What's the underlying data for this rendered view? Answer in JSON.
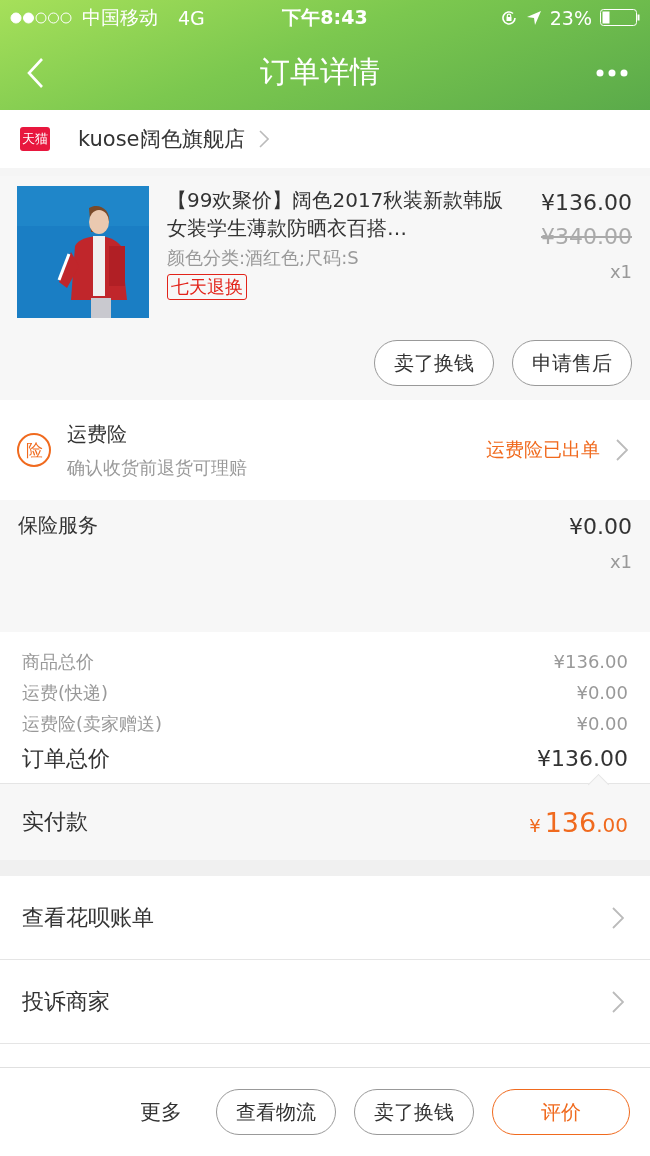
{
  "status_bar": {
    "carrier": "中国移动",
    "network": "4G",
    "time": "下午8:43",
    "battery": "23%"
  },
  "nav": {
    "title": "订单详情"
  },
  "store": {
    "badge": "天猫",
    "name": "kuose阔色旗舰店"
  },
  "product": {
    "title": "【99欢聚价】阔色2017秋装新款韩版女装学生薄款防晒衣百搭…",
    "price": "¥136.00",
    "original_price": "¥340.00",
    "quantity": "x1",
    "spec": "颜色分类:酒红色;尺码:S",
    "tag": "七天退换",
    "buttons": [
      "卖了换钱",
      "申请售后"
    ]
  },
  "shipping_insurance": {
    "badge": "险",
    "title": "运费险",
    "subtitle": "确认收货前退货可理赔",
    "status": "运费险已出单"
  },
  "insurance_service": {
    "title": "保险服务",
    "price": "¥0.00",
    "quantity": "x1"
  },
  "summary": [
    {
      "kind": "minor",
      "label": "商品总价",
      "value": "¥136.00"
    },
    {
      "kind": "minor",
      "label": "运费(快递)",
      "value": "¥0.00"
    },
    {
      "kind": "minor",
      "label": "运费险(卖家赠送)",
      "value": "¥0.00"
    },
    {
      "kind": "total",
      "label": "订单总价",
      "value": "¥136.00"
    }
  ],
  "paid": {
    "label": "实付款",
    "currency": "¥",
    "integer": "136",
    "decimals": ".00"
  },
  "links": [
    "查看花呗账单",
    "投诉商家"
  ],
  "bottom_bar": {
    "more": "更多",
    "buttons": [
      {
        "label": "查看物流",
        "kind": "normal"
      },
      {
        "label": "卖了换钱",
        "kind": "normal"
      },
      {
        "label": "评价",
        "kind": "primary"
      }
    ]
  }
}
